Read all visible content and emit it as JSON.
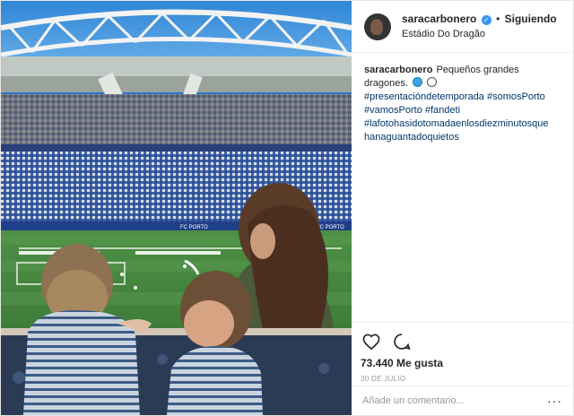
{
  "post": {
    "username": "saracarbonero",
    "follow_status": "Siguiendo",
    "location": "Estádio Do Dragão",
    "caption_text": "Pequeños grandes dragones.",
    "hashtags": [
      "#presentacióndetemporada #somosPorto",
      "#vamosPorto #fandeti",
      "#lafotohasidotomadaenlosdiezminutosque",
      "hanaguantadoquietos"
    ],
    "likes": "73.440 Me gusta",
    "date": "30 DE JULIO",
    "comment_placeholder": "Añade un comentario...",
    "more_label": "···"
  },
  "icons": {
    "verified": "verified-badge-icon",
    "like": "heart-icon",
    "comment": "speech-bubble-icon"
  },
  "colors": {
    "accent_blue": "#3897f0",
    "hashtag": "#003569",
    "border": "#efefef"
  },
  "stadium_signage": {
    "board_left": "FC PORTO",
    "board_right": "FC PORTO"
  }
}
